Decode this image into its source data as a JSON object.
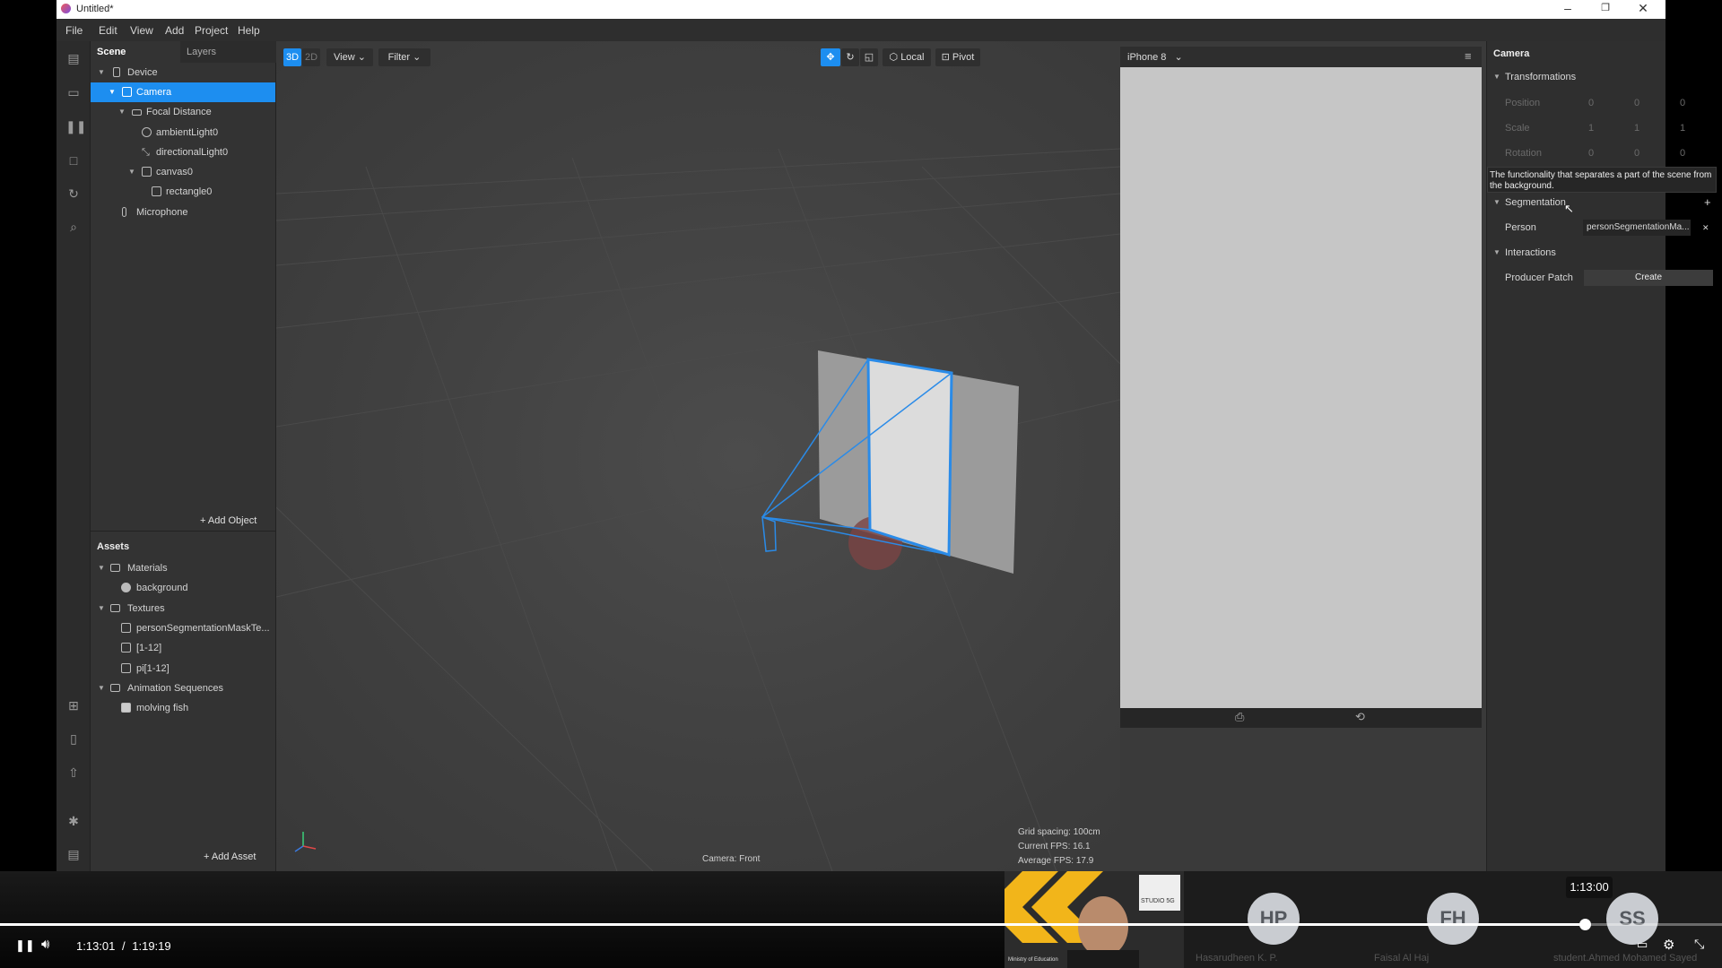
{
  "window": {
    "title": "Untitled*"
  },
  "menu": [
    "File",
    "Edit",
    "View",
    "Add",
    "Project",
    "Help"
  ],
  "left_toolbar_icons": [
    "layout-icon",
    "video-icon",
    "pause-bars-icon",
    "square-icon",
    "refresh-icon",
    "search-icon",
    "import-icon",
    "device-icon",
    "upload-icon",
    "bug-icon",
    "console-icon"
  ],
  "scene": {
    "tab_scene": "Scene",
    "tab_layers": "Layers",
    "items": [
      {
        "label": "Device"
      },
      {
        "label": "Camera"
      },
      {
        "label": "Focal Distance"
      },
      {
        "label": "ambientLight0"
      },
      {
        "label": "directionalLight0"
      },
      {
        "label": "canvas0"
      },
      {
        "label": "rectangle0"
      },
      {
        "label": "Microphone"
      }
    ],
    "add_object": "Add Object"
  },
  "assets": {
    "title": "Assets",
    "items": [
      {
        "label": "Materials"
      },
      {
        "label": "background"
      },
      {
        "label": "Textures"
      },
      {
        "label": "personSegmentationMaskTe..."
      },
      {
        "label": "[1-12]"
      },
      {
        "label": "pi[1-12]"
      },
      {
        "label": "Animation Sequences"
      },
      {
        "label": "molving fish"
      }
    ],
    "add_asset": "Add Asset"
  },
  "viewport": {
    "mode_3d": "3D",
    "mode_2d": "2D",
    "view": "View",
    "filter": "Filter",
    "local": "Local",
    "pivot": "Pivot",
    "camera_label": "Camera: Front",
    "grid_spacing": "Grid spacing: 100cm",
    "current_fps": "Current FPS:  16.1",
    "average_fps": "Average FPS:  17.9"
  },
  "simulator": {
    "device": "iPhone 8"
  },
  "inspector": {
    "title": "Camera",
    "transformations": "Transformations",
    "position": "Position",
    "scale": "Scale",
    "rotation": "Rotation",
    "position_values": [
      "0",
      "0",
      "0"
    ],
    "scale_values": [
      "1",
      "1",
      "1"
    ],
    "rotation_values": [
      "0",
      "0",
      "0"
    ],
    "tooltip": "The functionality that separates a part of the scene from the background.",
    "segmentation": "Segmentation",
    "person_label": "Person",
    "person_value": "personSegmentationMa...",
    "interactions": "Interactions",
    "producer_patch": "Producer Patch",
    "create": "Create"
  },
  "video": {
    "current_time": "1:13:01",
    "separator": "/",
    "total_time": "1:19:19",
    "hover_time": "1:13:00",
    "progress": 0.9201,
    "participants": [
      {
        "initials": "HP",
        "name": "Hasarudheen K. P."
      },
      {
        "initials": "FH",
        "name": "Faisal Al Haj"
      },
      {
        "initials": "SS",
        "name": "student.Ahmed Mohamed Sayed"
      }
    ],
    "presenter_logo_text": "STUDIO 5G",
    "presenter_caption": "Ministry of Education"
  }
}
